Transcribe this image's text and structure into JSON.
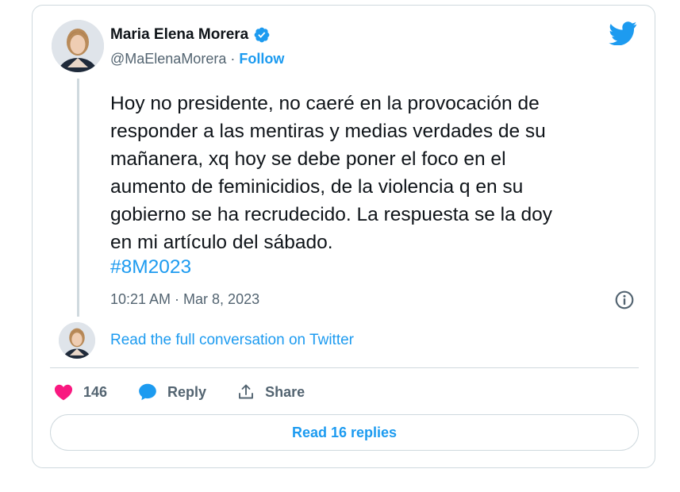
{
  "author": {
    "display_name": "Maria Elena Morera",
    "handle": "@MaElenaMorera",
    "separator": " · ",
    "follow_label": "Follow",
    "verified_icon": "verified-badge-icon"
  },
  "tweet": {
    "text": "Hoy no presidente, no caeré en la provocación de\nresponder a las mentiras y medias verdades de su\nmañanera, xq hoy se debe poner el foco en el\naumento de feminicidios, de la violencia q en su\ngobierno se ha recrudecido. La respuesta se la doy\nen mi artículo del sábado.",
    "hashtag": "#8M2023",
    "timestamp": "10:21 AM · Mar 8, 2023"
  },
  "conversation": {
    "link_label": "Read the full conversation on Twitter"
  },
  "actions": {
    "like_count": "146",
    "reply_label": "Reply",
    "share_label": "Share"
  },
  "footer": {
    "read_replies_label": "Read 16 replies"
  },
  "colors": {
    "accent": "#1d9bf0",
    "like": "#f91880",
    "secondary_text": "#536471",
    "border": "#cfd9de"
  },
  "icons": [
    "twitter-bird-icon",
    "verified-badge-icon",
    "info-icon",
    "heart-icon",
    "reply-bubble-icon",
    "share-icon"
  ]
}
